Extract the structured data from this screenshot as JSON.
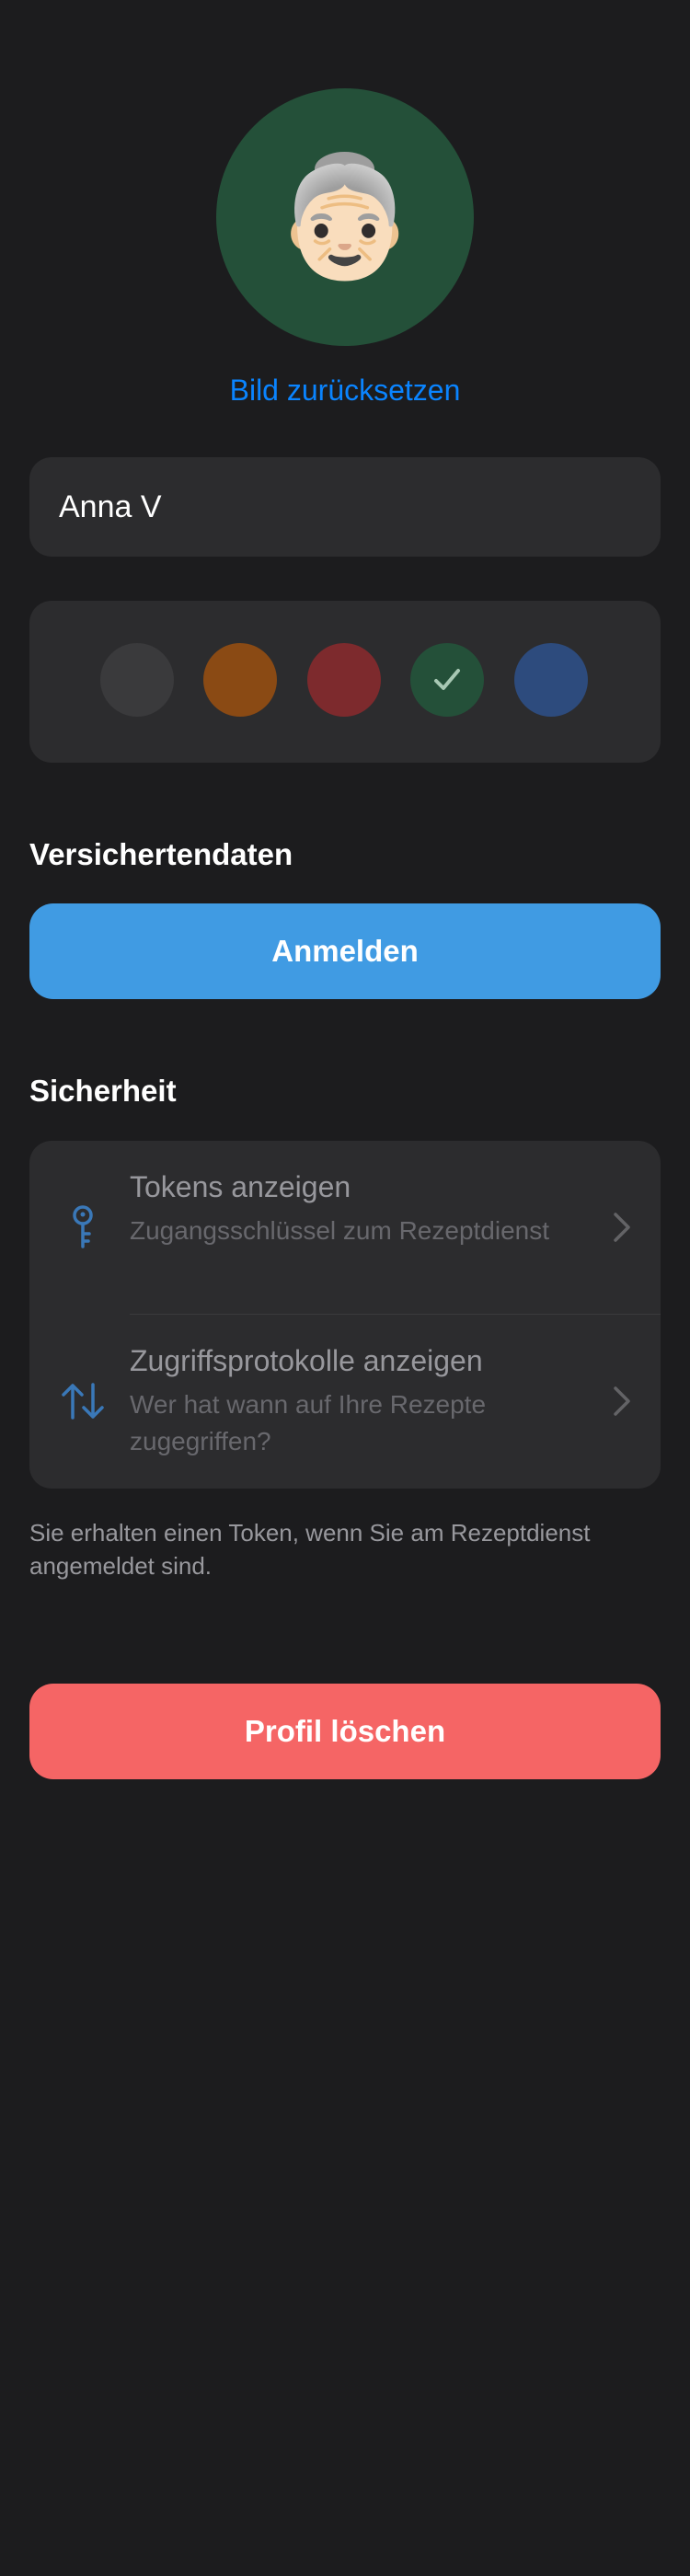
{
  "profile": {
    "avatar_emoji": "👵🏻",
    "avatar_icon": "grandma-emoji-icon",
    "avatar_color": "#245039",
    "reset_image_label": "Bild zurücksetzen",
    "name_value": "Anna V"
  },
  "color_picker": {
    "selected_index": 3,
    "swatches": [
      {
        "name": "gray",
        "color": "#3a3a3c"
      },
      {
        "name": "orange",
        "color": "#8a4a14"
      },
      {
        "name": "red",
        "color": "#7d2a2d"
      },
      {
        "name": "green",
        "color": "#245039"
      },
      {
        "name": "blue",
        "color": "#2d4b7d"
      }
    ],
    "check_icon": "checkmark-icon"
  },
  "insurance": {
    "section_title": "Versichertendaten",
    "login_label": "Anmelden"
  },
  "security": {
    "section_title": "Sicherheit",
    "items": [
      {
        "icon": "key-icon",
        "title": "Tokens anzeigen",
        "subtitle": "Zugangsschlüssel zum Rezeptdienst"
      },
      {
        "icon": "arrows-up-down-icon",
        "title": "Zugriffsprotokolle anzeigen",
        "subtitle": "Wer hat wann auf Ihre Rezepte zugegriffen?"
      }
    ],
    "footnote": "Sie erhalten einen Token, wenn Sie am Rezeptdienst angemeldet sind."
  },
  "danger": {
    "delete_label": "Profil löschen"
  },
  "colors": {
    "background": "#1c1c1e",
    "card": "#2c2c2e",
    "accent_link": "#0a84ff",
    "primary_button": "#409be3",
    "danger_button": "#f56565",
    "icon_tint": "#3a78b8"
  }
}
